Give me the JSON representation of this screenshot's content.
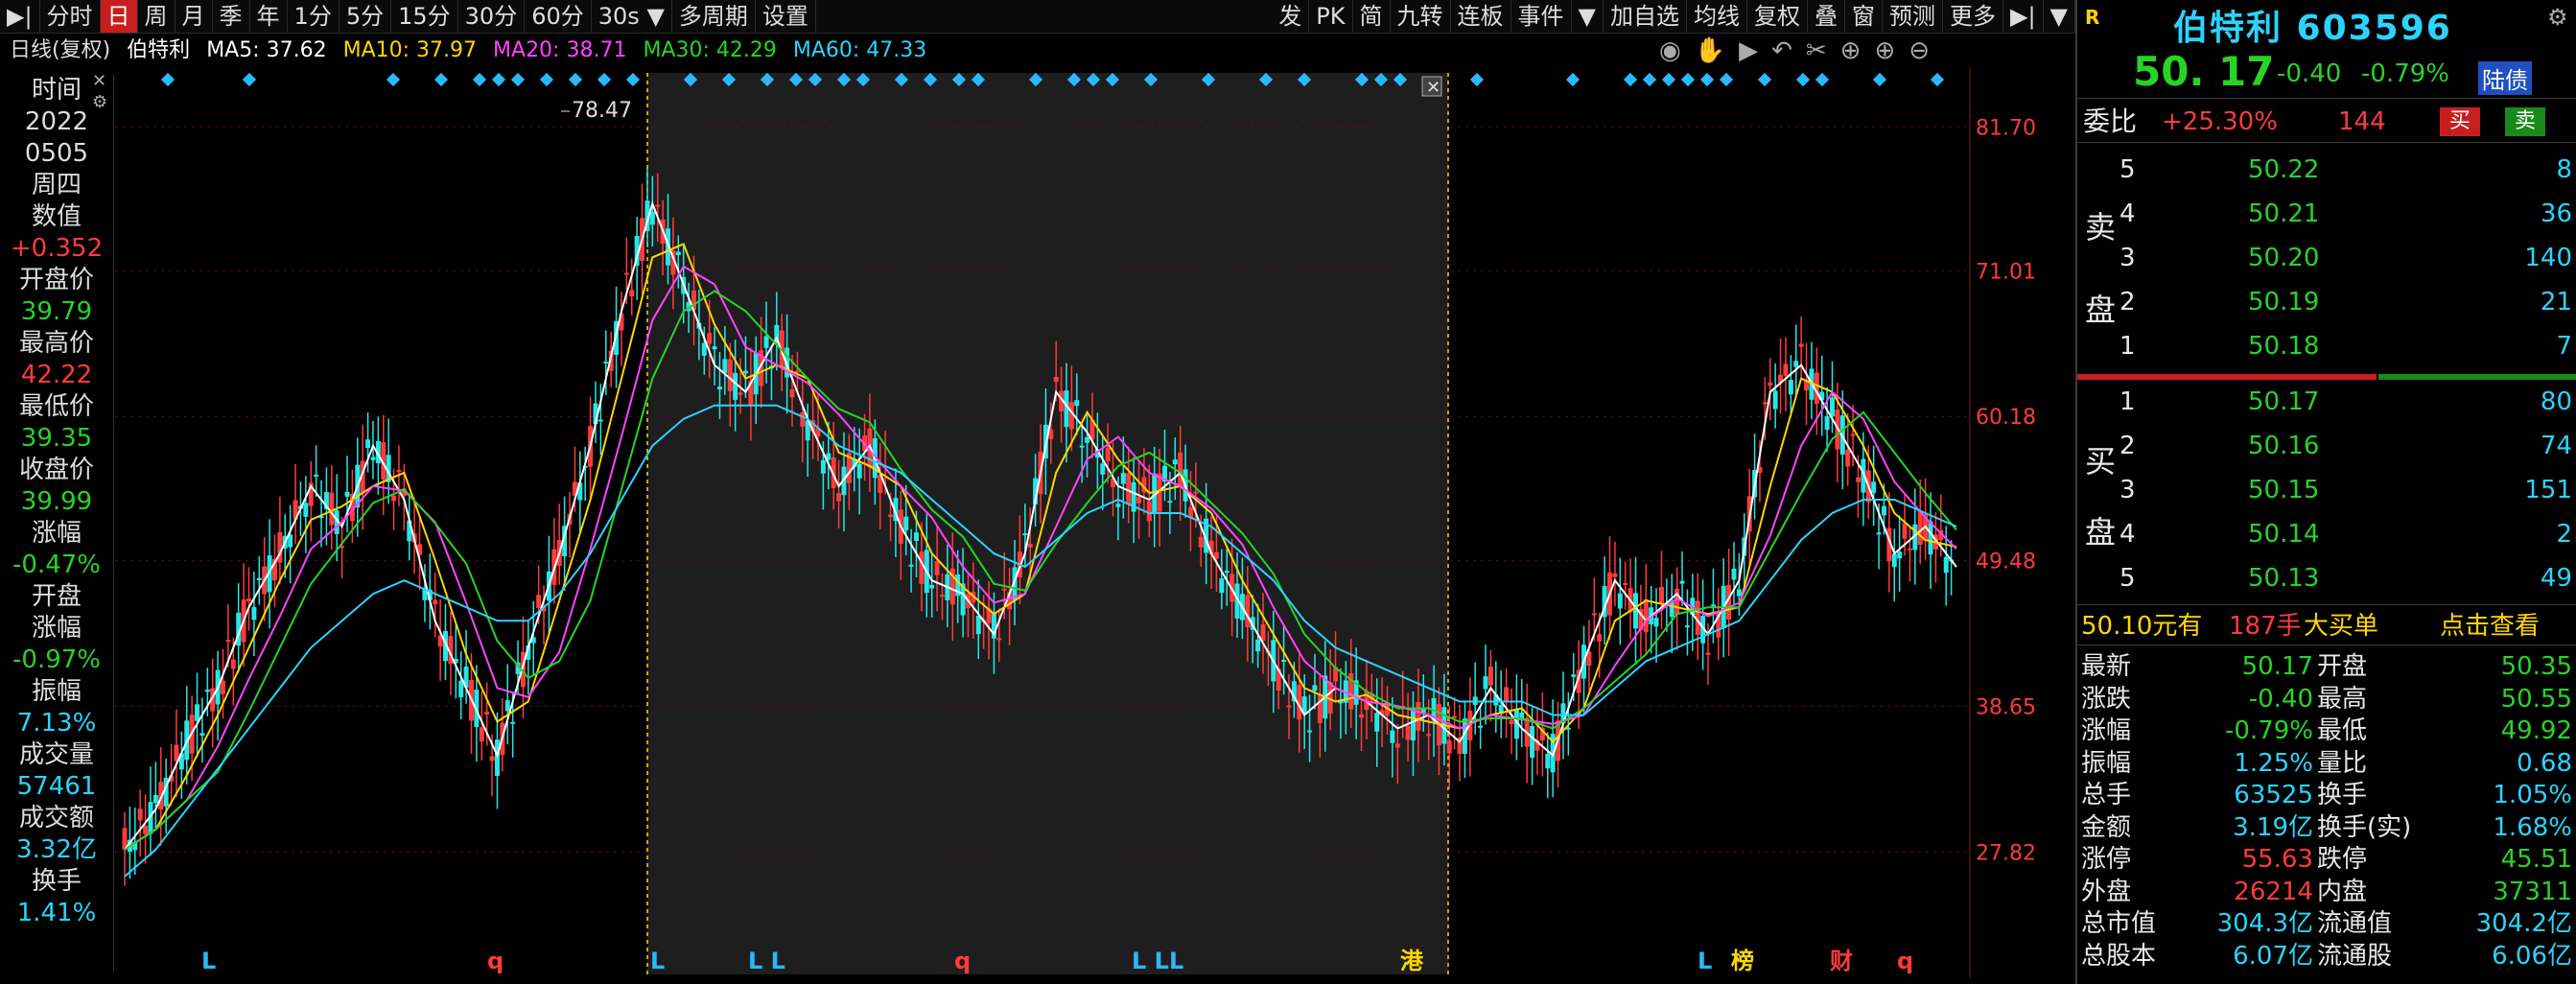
{
  "toolbar": {
    "items": [
      "分时",
      "日",
      "周",
      "月",
      "季",
      "年",
      "1分",
      "5分",
      "15分",
      "30分",
      "60分",
      "30s",
      "多周期",
      "设置"
    ],
    "active": "日",
    "right_items": [
      "发",
      "PK",
      "简",
      "九转",
      "连板",
      "事件",
      "加自选",
      "均线",
      "复权",
      "叠",
      "窗",
      "预测",
      "更多"
    ]
  },
  "legend": {
    "period": "日线(复权)",
    "stock": "伯特利",
    "ma5": "MA5: 37.62",
    "ma10": "MA10: 37.97",
    "ma20": "MA20: 38.71",
    "ma30": "MA30: 42.29",
    "ma60": "MA60: 47.33",
    "ma5_color": "#ffffff",
    "ma10_color": "#ffd700",
    "ma20_color": "#ff44ff",
    "ma30_color": "#26d426",
    "ma60_color": "#2ad4ff"
  },
  "left_panel": {
    "time_label": "时间",
    "year": "2022",
    "date": "0505",
    "weekday": "周四",
    "value_label": "数值",
    "value": "+0.352",
    "open_label": "开盘价",
    "open": "39.79",
    "high_label": "最高价",
    "high": "42.22",
    "low_label": "最低价",
    "low": "39.35",
    "close_label": "收盘价",
    "close": "39.99",
    "change_label": "涨幅",
    "change": "-0.47%",
    "open_change_label1": "开盘",
    "open_change_label2": "涨幅",
    "open_change": "-0.97%",
    "amplitude_label": "振幅",
    "amplitude": "7.13%",
    "volume_label": "成交量",
    "volume": "57461",
    "amount_label": "成交额",
    "amount": "3.32亿",
    "turnover_label": "换手",
    "turnover": "1.41%"
  },
  "price_axis": [
    "81.70",
    "71.01",
    "60.18",
    "49.48",
    "38.65",
    "27.82"
  ],
  "peak_label": "78.47",
  "event_markers": [
    "L",
    "q",
    "L",
    "L L",
    "q",
    "L LL",
    "港",
    "L",
    "榜",
    "财",
    "q"
  ],
  "quote": {
    "flag": "R",
    "name": "伯特利 603596",
    "price": "50. 17",
    "change": "-0.40",
    "change_pct": "-0.79%",
    "tag": "陆债",
    "webi_label": "委比",
    "webi_value": "+25.30%",
    "webi_count": "144",
    "buy_btn": "买",
    "sell_btn": "卖",
    "sell_label1": "卖",
    "sell_label2": "盘",
    "buy_label1": "买",
    "buy_label2": "盘",
    "asks": [
      {
        "lvl": "5",
        "price": "50.22",
        "vol": "8"
      },
      {
        "lvl": "4",
        "price": "50.21",
        "vol": "36"
      },
      {
        "lvl": "3",
        "price": "50.20",
        "vol": "140"
      },
      {
        "lvl": "2",
        "price": "50.19",
        "vol": "21"
      },
      {
        "lvl": "1",
        "price": "50.18",
        "vol": "7"
      }
    ],
    "bids": [
      {
        "lvl": "1",
        "price": "50.17",
        "vol": "80"
      },
      {
        "lvl": "2",
        "price": "50.16",
        "vol": "74"
      },
      {
        "lvl": "3",
        "price": "50.15",
        "vol": "151"
      },
      {
        "lvl": "4",
        "price": "50.14",
        "vol": "2"
      },
      {
        "lvl": "5",
        "price": "50.13",
        "vol": "49"
      }
    ],
    "big_order_price": "50.10元有",
    "big_order_count": "187手",
    "big_order_text": "大买单",
    "big_order_link": "点击查看",
    "stats": [
      {
        "k1": "最新",
        "v1": "50.17",
        "c1": "green",
        "k2": "开盘",
        "v2": "50.35",
        "c2": "green"
      },
      {
        "k1": "涨跌",
        "v1": "-0.40",
        "c1": "green",
        "k2": "最高",
        "v2": "50.55",
        "c2": "green"
      },
      {
        "k1": "涨幅",
        "v1": "-0.79%",
        "c1": "green",
        "k2": "最低",
        "v2": "49.92",
        "c2": "green"
      },
      {
        "k1": "振幅",
        "v1": "1.25%",
        "c1": "cyan",
        "k2": "量比",
        "v2": "0.68",
        "c2": "cyan"
      },
      {
        "k1": "总手",
        "v1": "63525",
        "c1": "cyan",
        "k2": "换手",
        "v2": "1.05%",
        "c2": "cyan"
      },
      {
        "k1": "金额",
        "v1": "3.19亿",
        "c1": "cyan",
        "k2": "换手(实)",
        "v2": "1.68%",
        "c2": "cyan"
      },
      {
        "k1": "涨停",
        "v1": "55.63",
        "c1": "red",
        "k2": "跌停",
        "v2": "45.51",
        "c2": "green"
      },
      {
        "k1": "外盘",
        "v1": "26214",
        "c1": "red",
        "k2": "内盘",
        "v2": "37311",
        "c2": "green"
      },
      {
        "k1": "总市值",
        "v1": "304.3亿",
        "c1": "cyan",
        "k2": "流通值",
        "v2": "304.2亿",
        "c2": "cyan"
      },
      {
        "k1": "总股本",
        "v1": "6.07亿",
        "c1": "cyan",
        "k2": "流通股",
        "v2": "6.06亿",
        "c2": "cyan"
      }
    ]
  },
  "chart_data": {
    "type": "line",
    "title": "",
    "xlabel": "",
    "ylabel": "",
    "ylim": [
      22,
      84
    ],
    "x": [
      0,
      5,
      10,
      15,
      20,
      25,
      30,
      35,
      40,
      45,
      50,
      55,
      60,
      65,
      70,
      75,
      80,
      85,
      90,
      95,
      100,
      105,
      110,
      115,
      120,
      125,
      130,
      135,
      140,
      145,
      150,
      155,
      160,
      165,
      170,
      175,
      180,
      185,
      190,
      195,
      200,
      205,
      210,
      215,
      220,
      225,
      230,
      235
    ],
    "series": [
      {
        "name": "price",
        "values": [
          28,
          31,
          36,
          40,
          46,
          50,
          55,
          52,
          58,
          54,
          45,
          40,
          35,
          43,
          50,
          58,
          68,
          76,
          70,
          64,
          62,
          66,
          60,
          55,
          58,
          52,
          48,
          47,
          44,
          50,
          62,
          59,
          55,
          54,
          56,
          50,
          46,
          42,
          38,
          40,
          39,
          37,
          38,
          36,
          40,
          37,
          35,
          42,
          48,
          45,
          47,
          44,
          48,
          62,
          64,
          60,
          56,
          50,
          52,
          49
        ]
      },
      {
        "name": "ma60",
        "values": [
          26,
          28,
          31,
          34,
          37,
          40,
          43,
          45,
          47,
          48,
          47,
          46,
          45,
          45,
          47,
          50,
          54,
          58,
          60,
          61,
          61,
          61,
          60,
          58,
          57,
          56,
          54,
          52,
          50,
          49,
          51,
          53,
          54,
          53,
          53,
          52,
          50,
          48,
          45,
          43,
          42,
          41,
          40,
          39,
          39,
          39,
          38,
          38,
          40,
          42,
          43,
          44,
          45,
          48,
          51,
          53,
          54,
          54,
          53,
          52
        ]
      }
    ]
  }
}
